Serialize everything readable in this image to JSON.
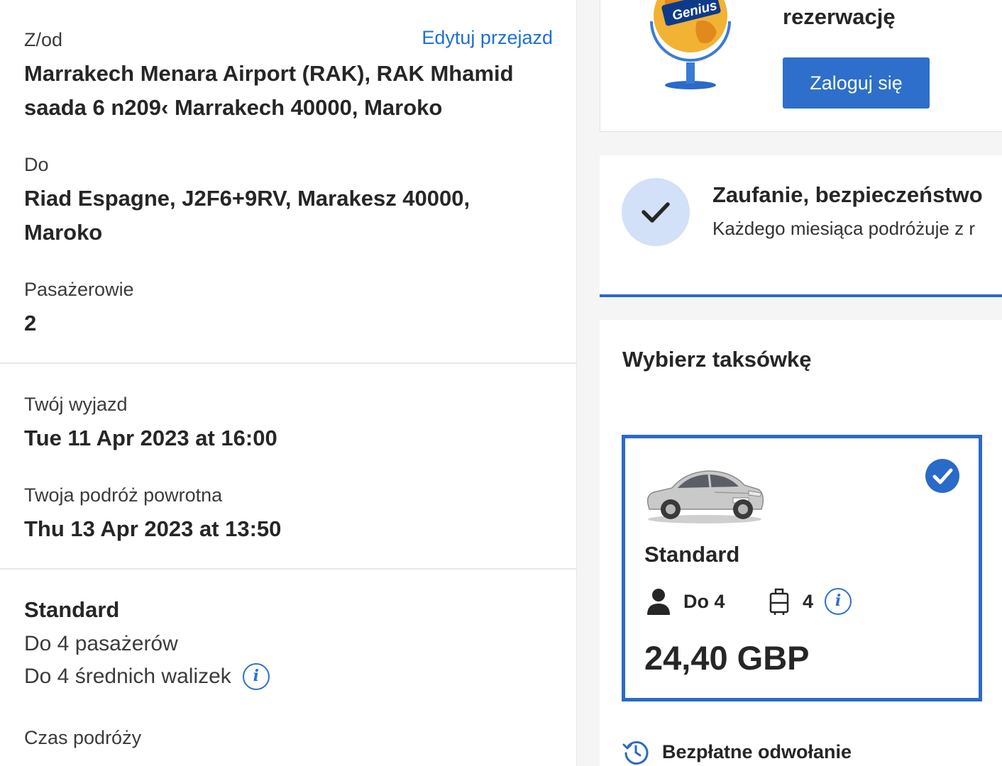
{
  "trip": {
    "from_label": "Z/od",
    "edit_link": "Edytuj przejazd",
    "from_line1": "Marrakech Menara Airport (RAK), RAK Mhamid",
    "from_line2": "saada 6 n209‹ Marrakech 40000, Maroko",
    "to_label": "Do",
    "to_line1": "Riad Espagne, J2F6+9RV, Marakesz 40000,",
    "to_line2": "Maroko",
    "passengers_label": "Pasażerowie",
    "passengers_value": "2"
  },
  "dates": {
    "departure_label": "Twój wyjazd",
    "departure_value": "Tue 11 Apr 2023 at 16:00",
    "return_label": "Twoja podróż powrotna",
    "return_value": "Thu 13 Apr 2023 at 13:50"
  },
  "vehicle_summary": {
    "name": "Standard",
    "passengers": "Do 4 pasażerów",
    "luggage": "Do 4 średnich walizek",
    "info_icon": "i",
    "travel_time_label": "Czas podróży"
  },
  "genius": {
    "badge": "Genius",
    "title": "rezerwację",
    "login_button": "Zaloguj się"
  },
  "trust": {
    "title": "Zaufanie, bezpieczeństwo",
    "subtitle": "Każdego miesiąca podróżuje z r"
  },
  "taxi": {
    "heading": "Wybierz taksówkę",
    "option": {
      "name": "Standard",
      "passengers": "Do 4",
      "luggage": "4",
      "info_icon": "i",
      "price": "24,40 GBP",
      "selected": true
    },
    "free_cancel": "Bezpłatne odwołanie"
  },
  "colors": {
    "accent": "#2a6ac9",
    "link": "#1f6fd1",
    "check_bg": "#d2e1f8"
  }
}
